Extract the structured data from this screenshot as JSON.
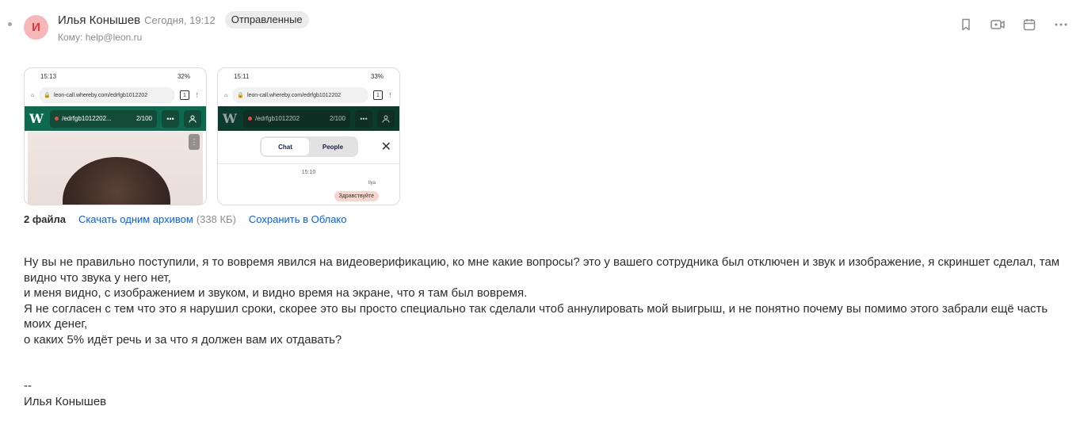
{
  "sender": {
    "avatar_letter": "И",
    "name": "Илья Конышев",
    "time": "Сегодня, 19:12",
    "folder_badge": "Отправленные",
    "to_label": "Кому:",
    "to_address": "help@leon.ru"
  },
  "toolbar": {
    "icons": [
      "bookmark-icon",
      "video-call-icon",
      "calendar-icon",
      "more-icon"
    ]
  },
  "attachments": [
    {
      "status_time": "15:13",
      "battery": "32%",
      "url": "leon-call.whereby.com/edrfgb1012202",
      "tabs": "1",
      "room": "/edrfgb1012202...",
      "count": "2/100"
    },
    {
      "status_time": "15:11",
      "battery": "33%",
      "url": "leon-call.whereby.com/edrfgb1012202",
      "tabs": "1",
      "room": "/edrfgb1012202",
      "count": "2/100",
      "chat_tab": "Chat",
      "people_tab": "People",
      "chat_time": "15:10",
      "chat_user": "Ilya",
      "chat_message": "Здравствуйте"
    }
  ],
  "files": {
    "count": "2 файла",
    "download_archive": "Скачать одним архивом",
    "size": "(338 КБ)",
    "save_cloud": "Сохранить в Облако"
  },
  "body": {
    "lines": [
      "Ну вы не правильно поступили, я то вовремя явился на видеоверификацию, ко мне какие вопросы? это  у вашего сотрудника был отключен и звук и изображение,  я скриншет сделал, там видно что звука у него нет,",
      "и меня видно, с изображением и звуком, и видно время на экране, что я там был вовремя.",
      "Я не согласен с тем что это я нарушил сроки, скорее это вы просто специально так сделали чтоб аннулировать мой выигрыш, и не понятно почему вы помимо этого забрали ещё часть моих денег,",
      "о каких 5% идёт речь и за что  я должен вам их отдавать?"
    ],
    "signature_dash": "--",
    "signature_name": "Илья Конышев"
  }
}
